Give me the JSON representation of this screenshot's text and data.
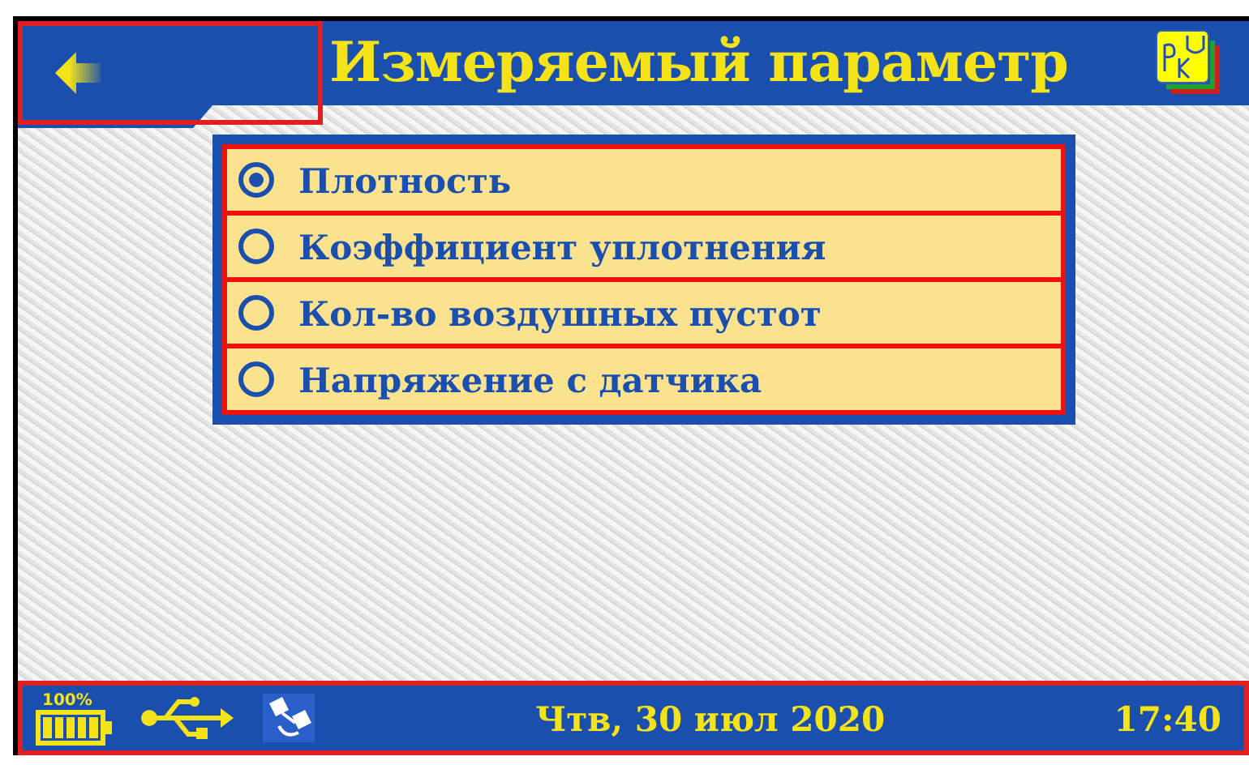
{
  "header": {
    "title": "Измеряемый параметр"
  },
  "options": [
    {
      "label": "Плотность",
      "selected": true
    },
    {
      "label": "Коэффициент уплотнения",
      "selected": false
    },
    {
      "label": "Кол-во воздушных пустот",
      "selected": false
    },
    {
      "label": "Напряжение с датчика",
      "selected": false
    }
  ],
  "status_bar": {
    "battery": "100%",
    "level": 1,
    "date": "Чтв, 30 июл 2020",
    "time": "17:40"
  }
}
